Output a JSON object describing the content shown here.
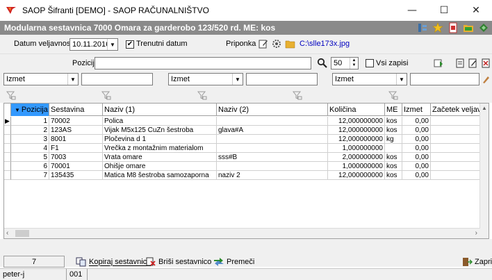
{
  "window": {
    "title": "SAOP Šifranti  [DEMO] - SAOP RAČUNALNIŠTVO",
    "minimize": "—",
    "maximize": "☐",
    "close": "✕"
  },
  "caption": {
    "text": "Modularna sestavnica 7000 Omara za garderobo 123/520 rd.   ME: kos"
  },
  "toolbar1": {
    "date_label": "Datum veljavnosti",
    "date_value": "10.11.2016",
    "current_date_label": "Trenutni datum",
    "current_date_checked": "✔",
    "attachment_label": "Priponka",
    "attachment_file": "C:\\slle173x.jpg"
  },
  "toolbar2": {
    "position_label": "Pozicija",
    "page_size": "50",
    "all_records_label": "Vsi zapisi"
  },
  "filters": [
    {
      "value": "Izmet"
    },
    {
      "value": "Izmet"
    },
    {
      "value": "Izmet"
    }
  ],
  "grid": {
    "columns": [
      "Pozicija",
      "Sestavina",
      "Naziv (1)",
      "Naziv (2)",
      "Količina",
      "ME",
      "Izmet",
      "Začetek veljavnosti"
    ],
    "sort_arrow": "▼",
    "current_row_marker": "▶",
    "rows": [
      {
        "pos": "1",
        "code": "70002",
        "name1": "Polica",
        "name2": "",
        "qty": "12,000000000",
        "me": "kos",
        "scrap": "0,00"
      },
      {
        "pos": "2",
        "code": "123AS",
        "name1": "Vijak M5x125 CuZn šestroba",
        "name2": "glava#A",
        "qty": "12,000000000",
        "me": "kos",
        "scrap": "0,00"
      },
      {
        "pos": "3",
        "code": "8001",
        "name1": "Pločevina d 1",
        "name2": "",
        "qty": "12,000000000",
        "me": "kg",
        "scrap": "0,00"
      },
      {
        "pos": "4",
        "code": "F1",
        "name1": "Vrečka z montažnim materialom",
        "name2": "",
        "qty": "1,000000000",
        "me": "",
        "scrap": "0,00"
      },
      {
        "pos": "5",
        "code": "7003",
        "name1": "Vrata omare",
        "name2": "sss#B",
        "qty": "2,000000000",
        "me": "kos",
        "scrap": "0,00"
      },
      {
        "pos": "6",
        "code": "70001",
        "name1": "Ohišje omare",
        "name2": "",
        "qty": "1,000000000",
        "me": "kos",
        "scrap": "0,00"
      },
      {
        "pos": "7",
        "code": "135435",
        "name1": "Matica M8 šestroba samozaporna",
        "name2": "naziv 2",
        "qty": "12,000000000",
        "me": "kos",
        "scrap": "0,00"
      }
    ]
  },
  "footer": {
    "count": "7",
    "copy_label": "Kopiraj sestavnico",
    "delete_label": "Briši sestavnico",
    "move_label": "Premeči",
    "close_label": "Zapri"
  },
  "statusbar": {
    "user": "peter-j",
    "company": "001"
  }
}
